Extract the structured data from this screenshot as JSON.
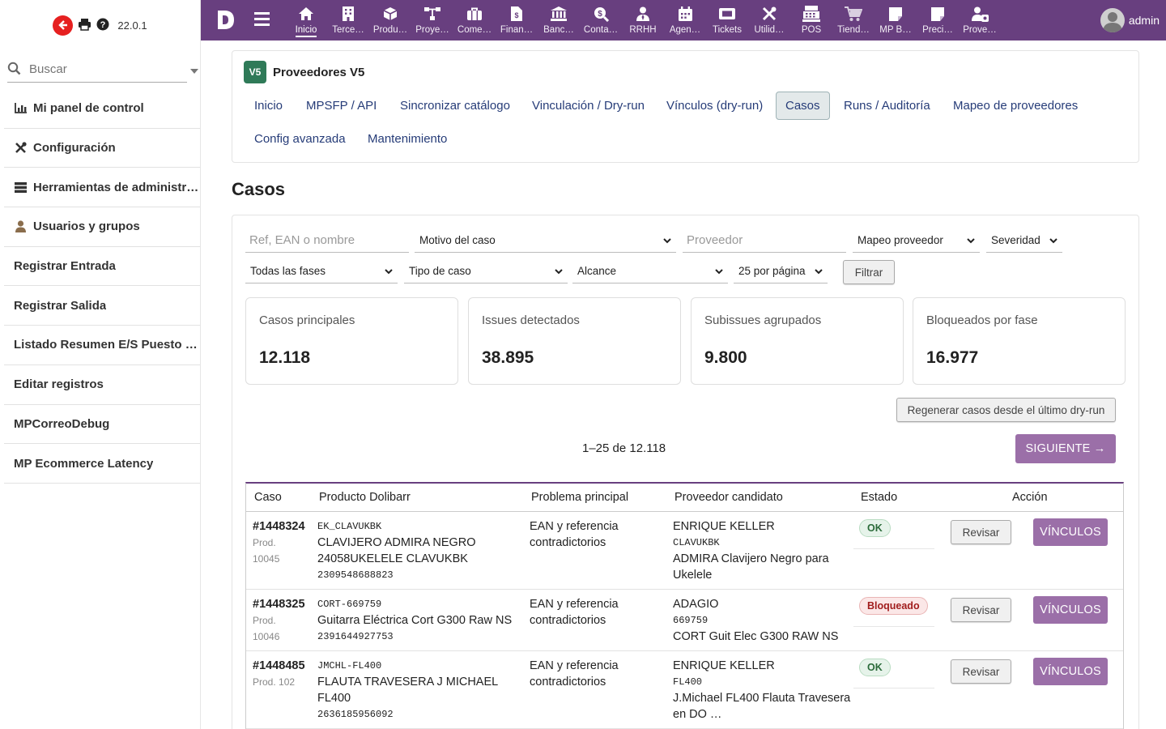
{
  "brand": {
    "version": "22.0.1"
  },
  "left": {
    "search_placeholder": "Buscar",
    "items": [
      {
        "label": "Mi panel de control",
        "icon": "chart-icon"
      },
      {
        "label": "Configuración",
        "icon": "tools-icon"
      },
      {
        "label": "Herramientas de administr…",
        "icon": "server-icon"
      },
      {
        "label": "Usuarios y grupos",
        "icon": "user-icon"
      },
      {
        "label": "Registrar Entrada"
      },
      {
        "label": "Registrar Salida"
      },
      {
        "label": "Listado Resumen E/S Puesto …"
      },
      {
        "label": "Editar registros"
      },
      {
        "label": "MPCorreoDebug"
      },
      {
        "label": "MP Ecommerce Latency"
      }
    ]
  },
  "topbar": {
    "menus": [
      {
        "label": "Inicio",
        "icon": "home-icon"
      },
      {
        "label": "Terce…",
        "icon": "building-icon"
      },
      {
        "label": "Produ…",
        "icon": "cube-icon"
      },
      {
        "label": "Proye…",
        "icon": "sitemap-icon"
      },
      {
        "label": "Come…",
        "icon": "suitcase-icon"
      },
      {
        "label": "Finan…",
        "icon": "invoice-icon"
      },
      {
        "label": "Banc…",
        "icon": "bank-icon"
      },
      {
        "label": "Conta…",
        "icon": "search-dollar-icon"
      },
      {
        "label": "RRHH",
        "icon": "user-tie-icon"
      },
      {
        "label": "Agen…",
        "icon": "calendar-icon"
      },
      {
        "label": "Tickets",
        "icon": "ticket-icon"
      },
      {
        "label": "Utilid…",
        "icon": "tools-icon"
      },
      {
        "label": "POS",
        "icon": "cash-register-icon"
      },
      {
        "label": "Tiend…",
        "icon": "cart-icon"
      },
      {
        "label": "MP B…",
        "icon": "note-icon"
      },
      {
        "label": "Preci…",
        "icon": "note-icon"
      },
      {
        "label": "Prove…",
        "icon": "user-cog-icon"
      }
    ],
    "user": "admin"
  },
  "module": {
    "badge": "V5",
    "title": "Proveedores V5",
    "tabs": [
      "Inicio",
      "MPSFP / API",
      "Sincronizar catálogo",
      "Vinculación / Dry-run",
      "Vínculos (dry-run)",
      "Casos",
      "Runs / Auditoría",
      "Mapeo de proveedores",
      "Config avanzada",
      "Mantenimiento"
    ],
    "active_tab": "Casos"
  },
  "page": {
    "title": "Casos"
  },
  "filters": {
    "ref_placeholder": "Ref, EAN o nombre",
    "motivo": "Motivo del caso",
    "proveedor_placeholder": "Proveedor",
    "mapeo": "Mapeo proveedor",
    "severidad": "Severidad",
    "fases": "Todas las fases",
    "tipo": "Tipo de caso",
    "alcance": "Alcance",
    "por_pagina": "25 por página",
    "filter_button": "Filtrar"
  },
  "kpis": [
    {
      "label": "Casos principales",
      "value": "12.118"
    },
    {
      "label": "Issues detectados",
      "value": "38.895"
    },
    {
      "label": "Subissues agrupados",
      "value": "9.800"
    },
    {
      "label": "Bloqueados por fase",
      "value": "16.977"
    }
  ],
  "actions": {
    "regenerate": "Regenerar casos desde el último dry-run",
    "pager": "1–25 de 12.118",
    "next": "SIGUIENTE →"
  },
  "table": {
    "headers": [
      "Caso",
      "Producto Dolibarr",
      "Problema principal",
      "Proveedor candidato",
      "Estado",
      "Acción"
    ],
    "rows": [
      {
        "case": "#1448324",
        "prod1": "Prod.",
        "prod2": "10045",
        "ref": "EK_CLAVUKBK",
        "name": "CLAVIJERO ADMIRA NEGRO 24058UKELELE CLAVUKBK",
        "ean": "2309548688823",
        "problem": "EAN y referencia contradictorios",
        "supplier": "ENRIQUE KELLER",
        "supref": "CLAVUKBK",
        "supdesc": "ADMIRA Clavijero Negro para Ukelele",
        "status": "OK",
        "review": "Revisar",
        "links": "VÍNCULOS"
      },
      {
        "case": "#1448325",
        "prod1": "Prod.",
        "prod2": "10046",
        "ref": "CORT-669759",
        "name": "Guitarra Eléctrica Cort G300 Raw NS",
        "ean": "2391644927753",
        "problem": "EAN y referencia contradictorios",
        "supplier": "ADAGIO",
        "supref": "669759",
        "supdesc": "CORT Guit Elec G300 RAW NS",
        "status": "Bloqueado",
        "review": "Revisar",
        "links": "VÍNCULOS"
      },
      {
        "case": "#1448485",
        "prod1": "Prod. 102",
        "prod2": "",
        "ref": "JMCHL-FL400",
        "name": "FLAUTA TRAVESERA J MICHAEL FL400",
        "ean": "2636185956092",
        "problem": "EAN y referencia contradictorios",
        "supplier": "ENRIQUE KELLER",
        "supref": "FL400",
        "supdesc": "J.Michael FL400 Flauta Travesera en DO …",
        "status": "OK",
        "review": "Revisar",
        "links": "VÍNCULOS"
      }
    ]
  },
  "colors": {
    "topbar": "#683f7f",
    "accent_button": "#9b6fa8",
    "badge_green": "#2f7a58",
    "logout": "#e62020"
  }
}
